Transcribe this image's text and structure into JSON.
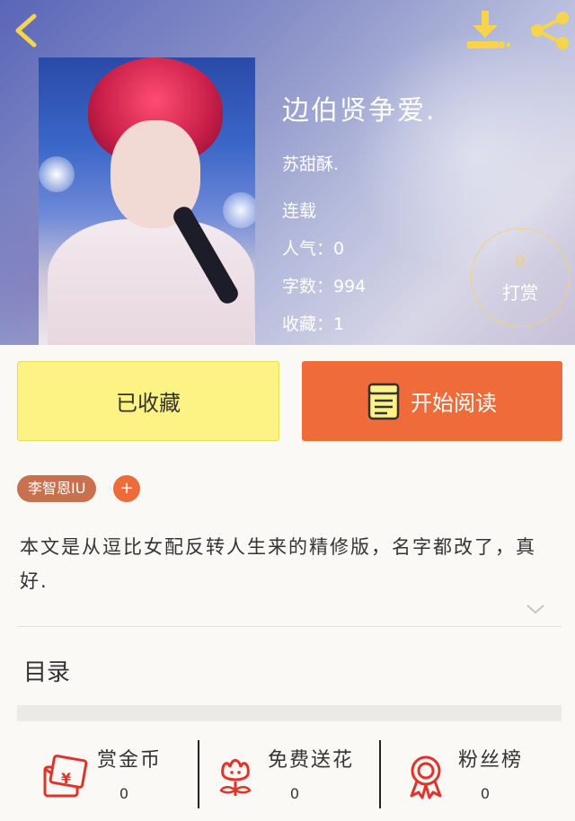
{
  "header": {
    "back_icon": "chevron-left-icon",
    "download_icon": "download-icon",
    "share_icon": "share-icon"
  },
  "book": {
    "title": "边伯贤争爱.",
    "author": "苏甜酥.",
    "status": "连载",
    "popularity": "人气：0",
    "word_count": "字数：994",
    "favorites": "收藏：1"
  },
  "tip": {
    "count": "0",
    "label": "打赏"
  },
  "actions": {
    "collect_label": "已收藏",
    "read_label": "开始阅读"
  },
  "tags": {
    "items": [
      "李智恩IU"
    ],
    "add_label": "+"
  },
  "description": "本文是从逗比女配反转人生来的精修版，名字都改了，真好.",
  "toc": {
    "title": "目录"
  },
  "footer": {
    "items": [
      {
        "label": "赏金币",
        "count": "0",
        "icon": "red-envelope-icon"
      },
      {
        "label": "免费送花",
        "count": "0",
        "icon": "flower-icon"
      },
      {
        "label": "粉丝榜",
        "count": "0",
        "icon": "medal-icon"
      }
    ]
  },
  "colors": {
    "accent_orange": "#ef6b3a",
    "collect_yellow": "#fdf384",
    "tag_brown": "#c9714f",
    "icon_yellow": "#f6d44c",
    "icon_red": "#e2332a"
  }
}
